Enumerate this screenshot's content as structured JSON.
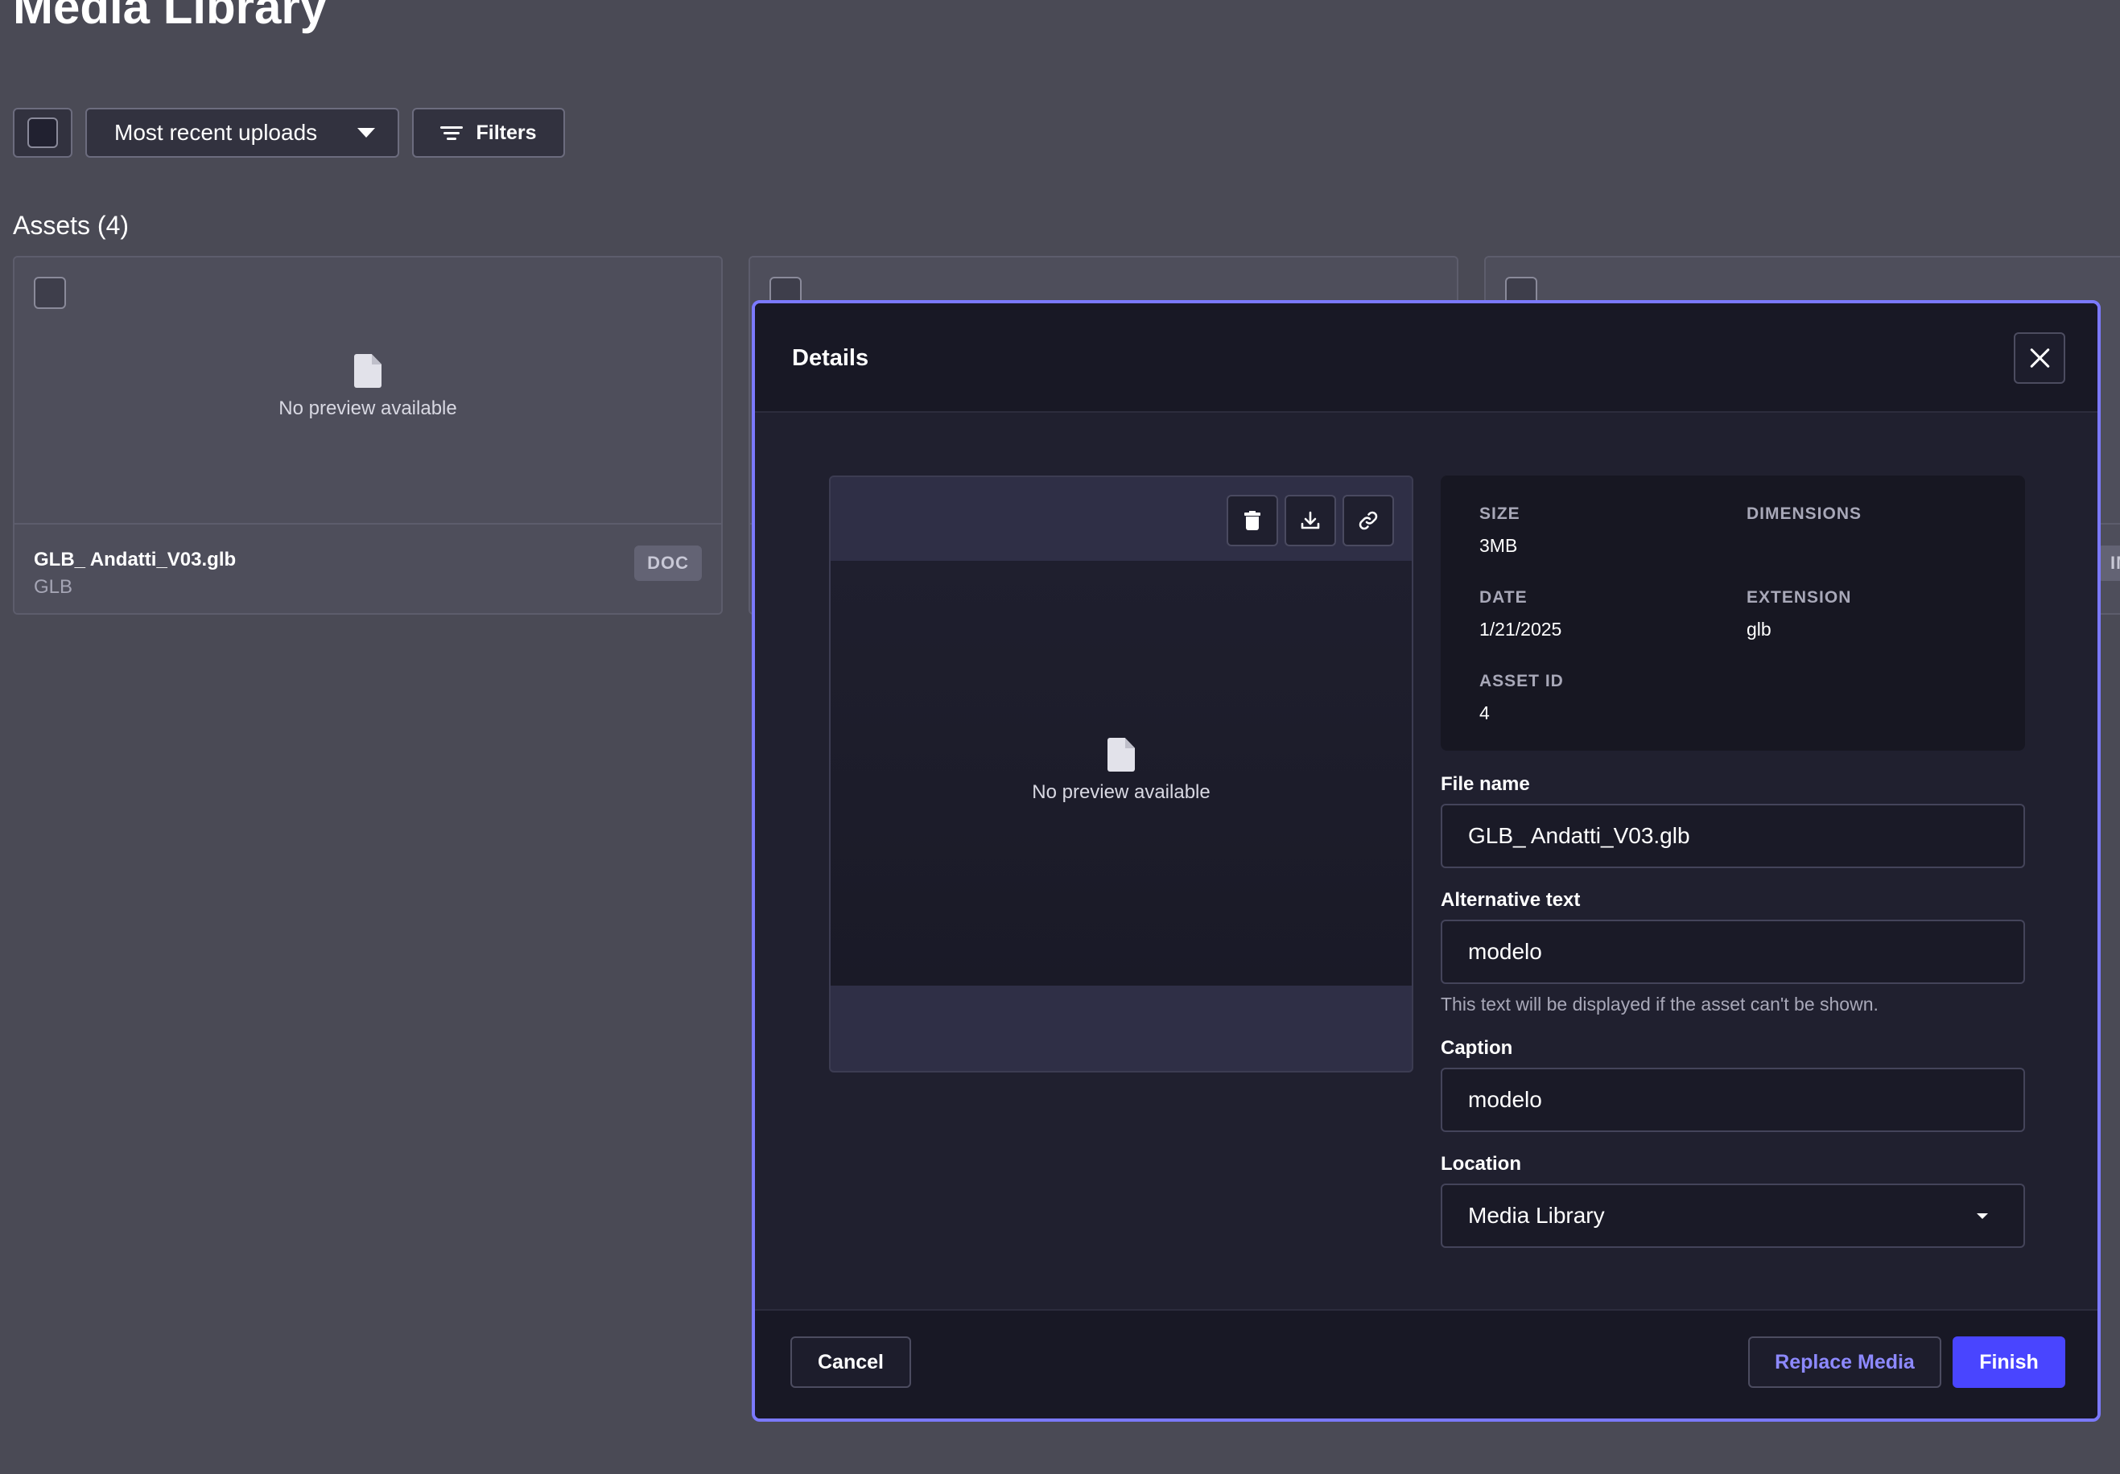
{
  "page": {
    "title": "Media Library"
  },
  "toolbar": {
    "sort_value": "Most recent uploads",
    "filters_label": "Filters"
  },
  "assets": {
    "heading": "Assets (4)",
    "cards": [
      {
        "name": "GLB_ Andatti_V03.glb",
        "ext": "GLB",
        "badge": "DOC",
        "preview_text": "No preview available"
      },
      {
        "badge": ""
      },
      {
        "badge": "IM"
      }
    ]
  },
  "modal": {
    "title": "Details",
    "preview_text": "No preview available",
    "meta": {
      "size_label": "SIZE",
      "size_value": "3MB",
      "dimensions_label": "DIMENSIONS",
      "date_label": "DATE",
      "date_value": "1/21/2025",
      "extension_label": "EXTENSION",
      "extension_value": "glb",
      "asset_id_label": "ASSET ID",
      "asset_id_value": "4"
    },
    "fields": {
      "file_name_label": "File name",
      "file_name_value": "GLB_ Andatti_V03.glb",
      "alt_label": "Alternative text",
      "alt_value": "modelo",
      "alt_hint": "This text will be displayed if the asset can't be shown.",
      "caption_label": "Caption",
      "caption_value": "modelo",
      "location_label": "Location",
      "location_value": "Media Library"
    },
    "buttons": {
      "cancel": "Cancel",
      "replace": "Replace Media",
      "finish": "Finish"
    }
  },
  "colors": {
    "accent": "#4945ff",
    "accent_border": "#7b79ff",
    "replace_text": "#8d89ff"
  },
  "icons": [
    "close-icon",
    "trash-icon",
    "download-icon",
    "link-icon",
    "document-icon",
    "filter-icon",
    "chevron-down-icon"
  ]
}
